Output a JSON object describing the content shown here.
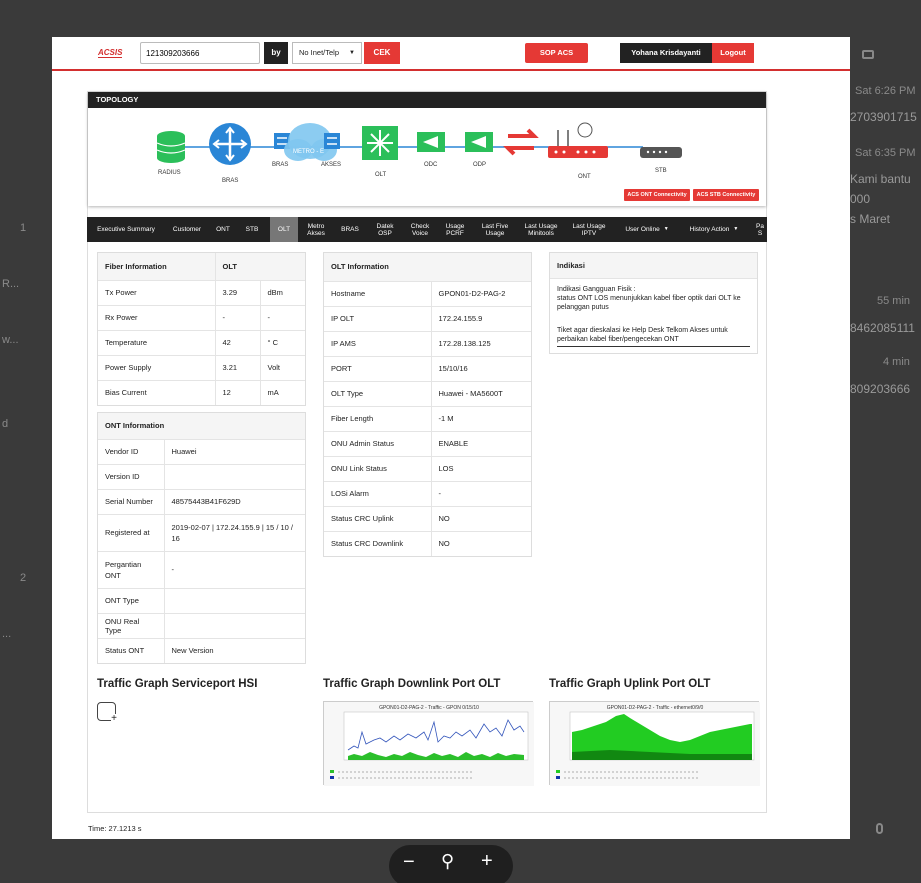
{
  "background": {
    "right_texts": [
      "Sat 6:26 PM",
      "2703901715",
      "Sat 6:35 PM",
      "Kami bantu",
      "000",
      "s Maret",
      "55 min",
      "8462085111",
      "4 min",
      "809203666"
    ],
    "left_texts": [
      "1",
      "R...",
      "w...",
      "d",
      "2",
      "..."
    ]
  },
  "header": {
    "logo": "ACSIS",
    "search_value": "121309203666",
    "by_label": "by",
    "select_value": "No Inet/Telp",
    "cek_label": "CEK",
    "sop_label": "SOP ACS",
    "user_name": "Yohana Krisdayanti",
    "logout_label": "Logout"
  },
  "topology": {
    "title": "TOPOLOGY",
    "nodes": [
      "RADIUS",
      "BRAS",
      "BRAS",
      "METRO - E",
      "AKSES",
      "OLT",
      "ODC",
      "ODP",
      "ONT",
      "STB"
    ],
    "ont_button": "ACS ONT Connectivity",
    "stb_button": "ACS STB Connectivity",
    "colors": {
      "green": "#2bbf5a",
      "blue": "#2a86d6",
      "red": "#e53935"
    }
  },
  "nav": [
    "Executive Summary",
    "Customer",
    "ONT",
    "STB",
    "OLT",
    "Metro Akses",
    "BRAS",
    "Datek OSP",
    "Check Voice",
    "Usage PCRF",
    "Last Five Usage",
    "Last Usage Minitools",
    "Last Usage IPTV",
    "User Online",
    "History Action",
    "Pa S"
  ],
  "fiber": {
    "header": [
      "Fiber Information",
      "OLT"
    ],
    "rows": [
      [
        "Tx Power",
        "3.29",
        "dBm"
      ],
      [
        "Rx Power",
        "-",
        "-"
      ],
      [
        "Temperature",
        "42",
        "° C"
      ],
      [
        "Power Supply",
        "3.21",
        "Volt"
      ],
      [
        "Bias Current",
        "12",
        "mA"
      ]
    ]
  },
  "ont": {
    "header": "ONT Information",
    "rows": [
      [
        "Vendor ID",
        "Huawei"
      ],
      [
        "Version ID",
        ""
      ],
      [
        "Serial Number",
        "48575443B41F629D"
      ],
      [
        "Registered at",
        "2019-02-07 | 172.24.155.9 | 15 / 10 / 16"
      ],
      [
        "Pergantian ONT",
        "-"
      ],
      [
        "ONT Type",
        ""
      ],
      [
        "ONU Real Type",
        ""
      ],
      [
        "Status ONT",
        "New Version"
      ]
    ]
  },
  "olt": {
    "header": "OLT Information",
    "rows": [
      [
        "Hostname",
        "GPON01-D2-PAG-2"
      ],
      [
        "IP OLT",
        "172.24.155.9"
      ],
      [
        "IP AMS",
        "172.28.138.125"
      ],
      [
        "PORT",
        "15/10/16"
      ],
      [
        "OLT Type",
        "Huawei - MA5600T"
      ],
      [
        "Fiber Length",
        "-1 M"
      ],
      [
        "ONU Admin Status",
        "ENABLE"
      ],
      [
        "ONU Link Status",
        "LOS"
      ],
      [
        "LOSi Alarm",
        "-"
      ],
      [
        "Status CRC Uplink",
        "NO"
      ],
      [
        "Status CRC Downlink",
        "NO"
      ]
    ]
  },
  "indikasi": {
    "header": "Indikasi",
    "line1": "Indikasi Gangguan Fisik :",
    "line2": "status ONT LOS menunjukkan kabel fiber optik dari OLT ke pelanggan putus",
    "line3": "Tiket agar dieskalasi ke Help Desk Telkom Akses untuk perbaikan kabel fiber/pengecekan ONT"
  },
  "graphs": {
    "hsi_title": "Traffic Graph Serviceport HSI",
    "down_title": "Traffic Graph Downlink Port OLT",
    "up_title": "Traffic Graph Uplink Port OLT",
    "down_caption": "GPON01-D2-PAG-2 - Traffic - GPON 0/15/10",
    "up_caption": "GPON01-D2-PAG-2 - Traffic - ethernet0/9/0"
  },
  "footer": {
    "time": "Time: 27.1213 s"
  }
}
